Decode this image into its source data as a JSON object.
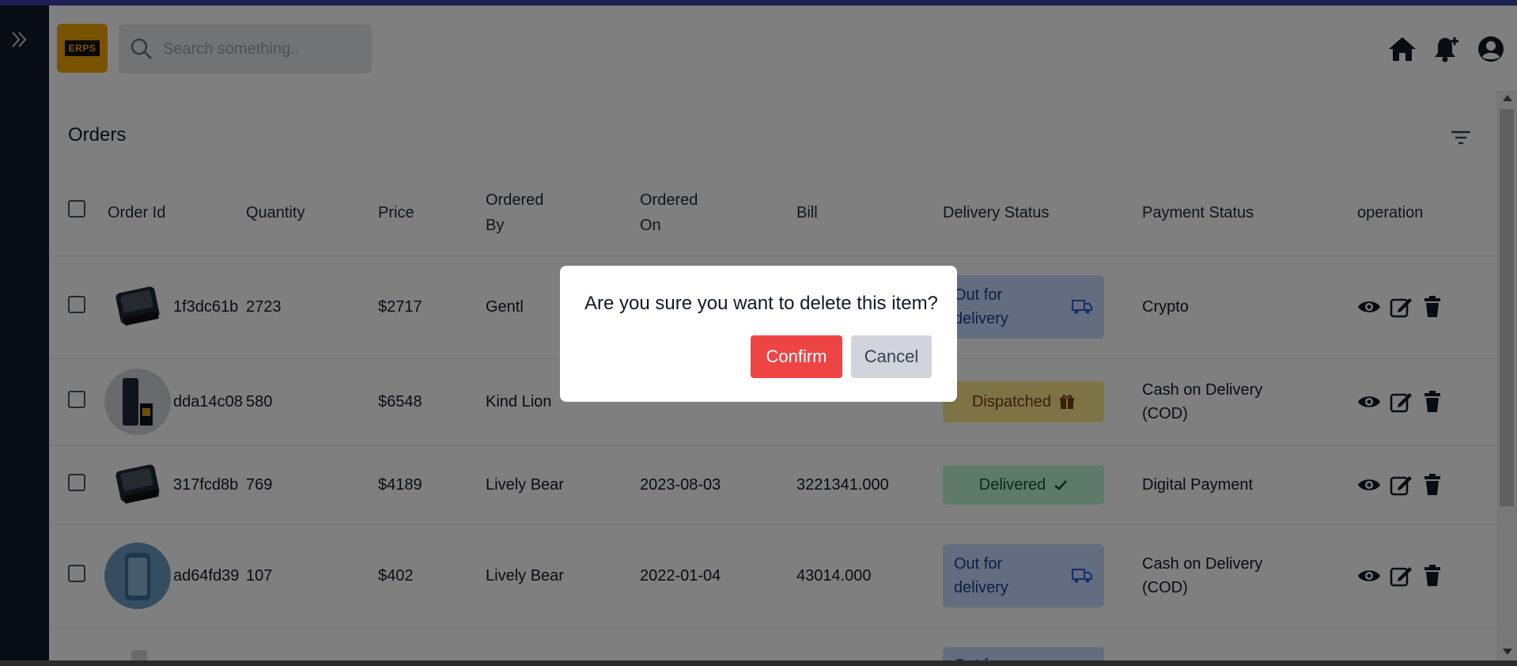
{
  "app": {
    "logo_text": "ERPS",
    "search": {
      "placeholder": "Search something.."
    },
    "header_icons": [
      "home-icon",
      "bell-plus-icon",
      "user-circle-icon"
    ]
  },
  "page": {
    "title": "Orders"
  },
  "table": {
    "headers": {
      "order_id": "Order Id",
      "quantity": "Quantity",
      "price": "Price",
      "ordered_by_1": "Ordered",
      "ordered_by_2": "By",
      "ordered_on_1": "Ordered",
      "ordered_on_2": "On",
      "bill": "Bill",
      "delivery_status": "Delivery Status",
      "payment_status": "Payment Status",
      "operation": "operation"
    },
    "rows": [
      {
        "order_id": "1f3dc61b",
        "quantity": "2723",
        "price": "$2717",
        "ordered_by": "Gentl",
        "ordered_on": "",
        "bill": "",
        "delivery_line1": "Out for",
        "delivery_line2": "delivery",
        "delivery_status": "Out for delivery",
        "payment_line1": "Crypto",
        "payment_line2": "",
        "image": "slider-phone"
      },
      {
        "order_id": "dda14c08",
        "quantity": "580",
        "price": "$6548",
        "ordered_by": "Kind Lion",
        "ordered_on": "",
        "bill": "",
        "delivery_status": "Dispatched",
        "payment_line1": "Cash on Delivery",
        "payment_line2": "(COD)",
        "image": "phone-box"
      },
      {
        "order_id": "317fcd8b",
        "quantity": "769",
        "price": "$4189",
        "ordered_by": "Lively Bear",
        "ordered_on": "2023-08-03",
        "bill": "3221341.000",
        "delivery_status": "Delivered",
        "payment_line1": "Digital Payment",
        "payment_line2": "",
        "image": "slider-phone"
      },
      {
        "order_id": "ad64fd39",
        "quantity": "107",
        "price": "$402",
        "ordered_by": "Lively Bear",
        "ordered_on": "2022-01-04",
        "bill": "43014.000",
        "delivery_line1": "Out for",
        "delivery_line2": "delivery",
        "delivery_status": "Out for delivery",
        "payment_line1": "Cash on Delivery",
        "payment_line2": "(COD)",
        "image": "blue-phone"
      }
    ],
    "partial_row": {
      "delivery_line1": "Out for"
    }
  },
  "modal": {
    "message": "Are you sure you want to delete this item?",
    "confirm_label": "Confirm",
    "cancel_label": "Cancel"
  },
  "colors": {
    "accent_bar": "#3b3fa8",
    "confirm": "#ef4444",
    "out_for_delivery": "#c7dbff",
    "dispatched": "#fde68a",
    "delivered": "#bbf7d0"
  }
}
